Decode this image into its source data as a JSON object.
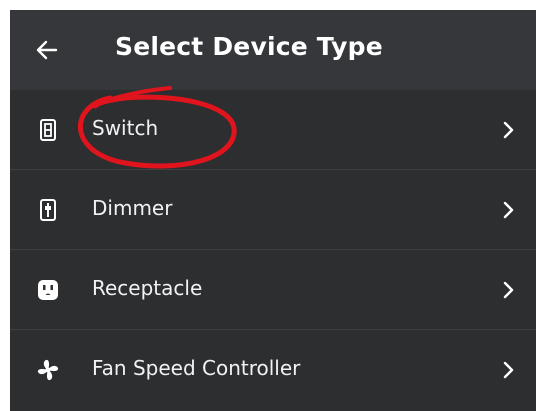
{
  "header": {
    "back_icon": "arrow-left-icon",
    "title": "Select Device Type"
  },
  "device_types": [
    {
      "label": "Switch",
      "icon": "switch-icon"
    },
    {
      "label": "Dimmer",
      "icon": "dimmer-icon"
    },
    {
      "label": "Receptacle",
      "icon": "receptacle-icon"
    },
    {
      "label": "Fan Speed Controller",
      "icon": "fan-icon"
    }
  ],
  "colors": {
    "background": "#2c2e30",
    "header_background": "#35373a",
    "text": "#ffffff",
    "divider": "#3d3f42",
    "annotation": "#e0141c"
  }
}
